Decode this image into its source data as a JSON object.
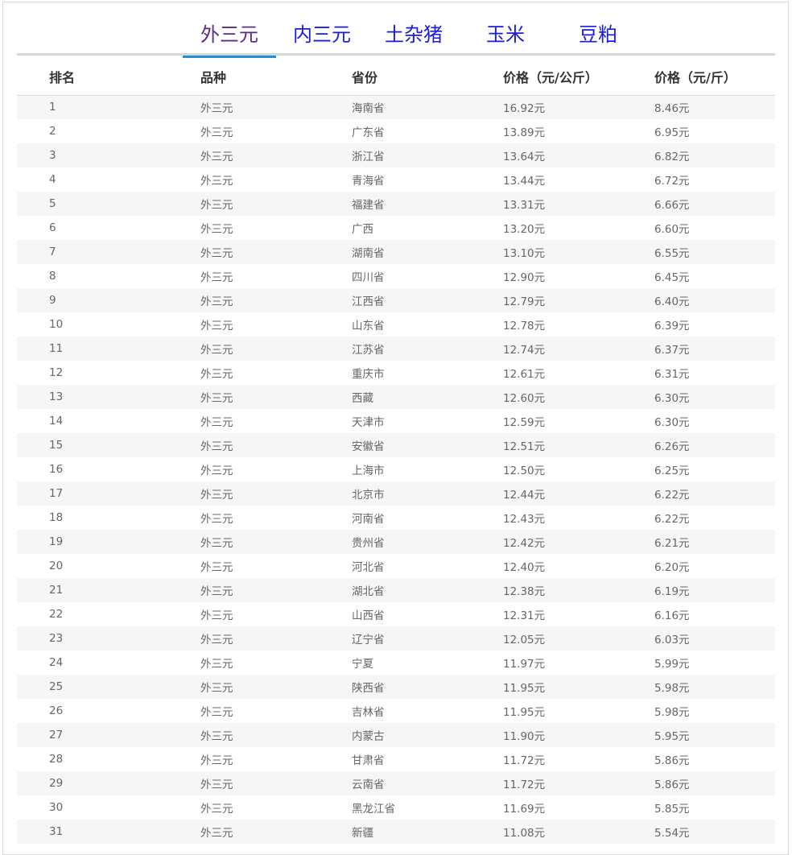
{
  "tabs": [
    {
      "label": "外三元",
      "active": true
    },
    {
      "label": "内三元",
      "active": false
    },
    {
      "label": "土杂猪",
      "active": false
    },
    {
      "label": "玉米",
      "active": false
    },
    {
      "label": "豆粕",
      "active": false
    }
  ],
  "table": {
    "headers": [
      "排名",
      "品种",
      "省份",
      "价格（元/公斤）",
      "价格（元/斤）"
    ],
    "rows": [
      [
        "1",
        "外三元",
        "海南省",
        "16.92元",
        "8.46元"
      ],
      [
        "2",
        "外三元",
        "广东省",
        "13.89元",
        "6.95元"
      ],
      [
        "3",
        "外三元",
        "浙江省",
        "13.64元",
        "6.82元"
      ],
      [
        "4",
        "外三元",
        "青海省",
        "13.44元",
        "6.72元"
      ],
      [
        "5",
        "外三元",
        "福建省",
        "13.31元",
        "6.66元"
      ],
      [
        "6",
        "外三元",
        "广西",
        "13.20元",
        "6.60元"
      ],
      [
        "7",
        "外三元",
        "湖南省",
        "13.10元",
        "6.55元"
      ],
      [
        "8",
        "外三元",
        "四川省",
        "12.90元",
        "6.45元"
      ],
      [
        "9",
        "外三元",
        "江西省",
        "12.79元",
        "6.40元"
      ],
      [
        "10",
        "外三元",
        "山东省",
        "12.78元",
        "6.39元"
      ],
      [
        "11",
        "外三元",
        "江苏省",
        "12.74元",
        "6.37元"
      ],
      [
        "12",
        "外三元",
        "重庆市",
        "12.61元",
        "6.31元"
      ],
      [
        "13",
        "外三元",
        "西藏",
        "12.60元",
        "6.30元"
      ],
      [
        "14",
        "外三元",
        "天津市",
        "12.59元",
        "6.30元"
      ],
      [
        "15",
        "外三元",
        "安徽省",
        "12.51元",
        "6.26元"
      ],
      [
        "16",
        "外三元",
        "上海市",
        "12.50元",
        "6.25元"
      ],
      [
        "17",
        "外三元",
        "北京市",
        "12.44元",
        "6.22元"
      ],
      [
        "18",
        "外三元",
        "河南省",
        "12.43元",
        "6.22元"
      ],
      [
        "19",
        "外三元",
        "贵州省",
        "12.42元",
        "6.21元"
      ],
      [
        "20",
        "外三元",
        "河北省",
        "12.40元",
        "6.20元"
      ],
      [
        "21",
        "外三元",
        "湖北省",
        "12.38元",
        "6.19元"
      ],
      [
        "22",
        "外三元",
        "山西省",
        "12.31元",
        "6.16元"
      ],
      [
        "23",
        "外三元",
        "辽宁省",
        "12.05元",
        "6.03元"
      ],
      [
        "24",
        "外三元",
        "宁夏",
        "11.97元",
        "5.99元"
      ],
      [
        "25",
        "外三元",
        "陕西省",
        "11.95元",
        "5.98元"
      ],
      [
        "26",
        "外三元",
        "吉林省",
        "11.95元",
        "5.98元"
      ],
      [
        "27",
        "外三元",
        "内蒙古",
        "11.90元",
        "5.95元"
      ],
      [
        "28",
        "外三元",
        "甘肃省",
        "11.72元",
        "5.86元"
      ],
      [
        "29",
        "外三元",
        "云南省",
        "11.72元",
        "5.86元"
      ],
      [
        "30",
        "外三元",
        "黑龙江省",
        "11.69元",
        "5.85元"
      ],
      [
        "31",
        "外三元",
        "新疆",
        "11.08元",
        "5.54元"
      ]
    ]
  }
}
